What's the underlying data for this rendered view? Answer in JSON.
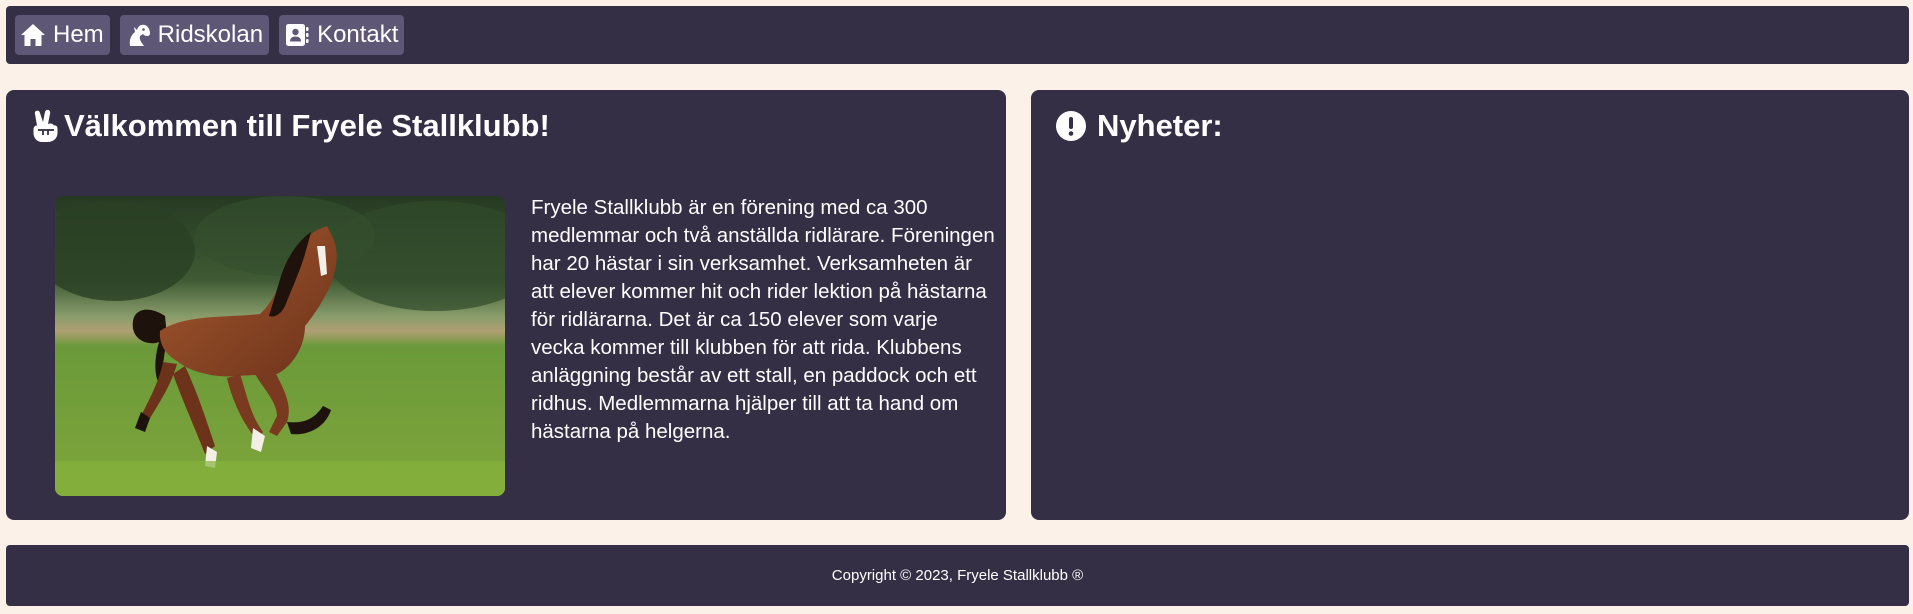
{
  "nav": {
    "items": [
      {
        "label": "Hem",
        "icon": "home-icon"
      },
      {
        "label": "Ridskolan",
        "icon": "horse-head-icon"
      },
      {
        "label": "Kontakt",
        "icon": "address-book-icon"
      }
    ]
  },
  "welcome": {
    "title": "Välkommen till Fryele Stallklubb!",
    "icon": "peace-hand-icon",
    "image_alt": "horse-photo",
    "text": "Fryele Stallklubb är en förening med ca 300 medlemmar och två anställda ridlärare. Föreningen har 20 hästar i sin verksamhet. Verksamheten är att elever kommer hit och rider lektion på hästarna för ridlärarna. Det är ca 150 elever som varje vecka kommer till klubben för att rida. Klubbens anläggning består av ett stall, en paddock och ett ridhus. Medlemmarna hjälper till att ta hand om hästarna på helgerna."
  },
  "news": {
    "title": "Nyheter:",
    "icon": "exclamation-circle-icon"
  },
  "footer": {
    "copyright": "Copyright © 2023, Fryele Stallklubb ®"
  },
  "colors": {
    "page_background": "#fbf1e8",
    "panel": "#342f45",
    "nav_button": "#5e5775",
    "text": "#ffffff"
  }
}
